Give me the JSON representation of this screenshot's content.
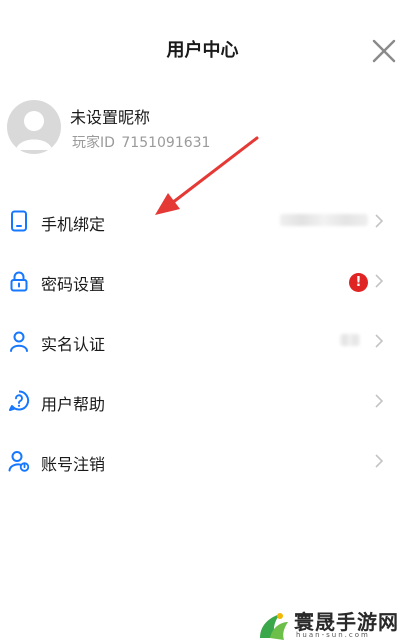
{
  "header": {
    "title": "用户中心",
    "close_icon": "close-icon"
  },
  "profile": {
    "avatar_icon": "avatar-icon",
    "nickname": "未设置昵称",
    "id_label": "玩家ID",
    "id_value": "7151091631"
  },
  "menu": {
    "items": [
      {
        "label": "手机绑定",
        "icon": "phone-icon",
        "value_blurred": true
      },
      {
        "label": "密码设置",
        "icon": "lock-icon",
        "badge": "!"
      },
      {
        "label": "实名认证",
        "icon": "person-icon",
        "value_blurred": true
      },
      {
        "label": "用户帮助",
        "icon": "help-icon"
      },
      {
        "label": "账号注销",
        "icon": "user-logout-icon"
      }
    ]
  },
  "colors": {
    "accent": "#1677ff",
    "badge": "#e02424",
    "arrow": "#e53935",
    "muted": "#9a9a9a"
  },
  "watermark": {
    "text": "寰晟手游网",
    "sub": "huan-sun.com"
  }
}
